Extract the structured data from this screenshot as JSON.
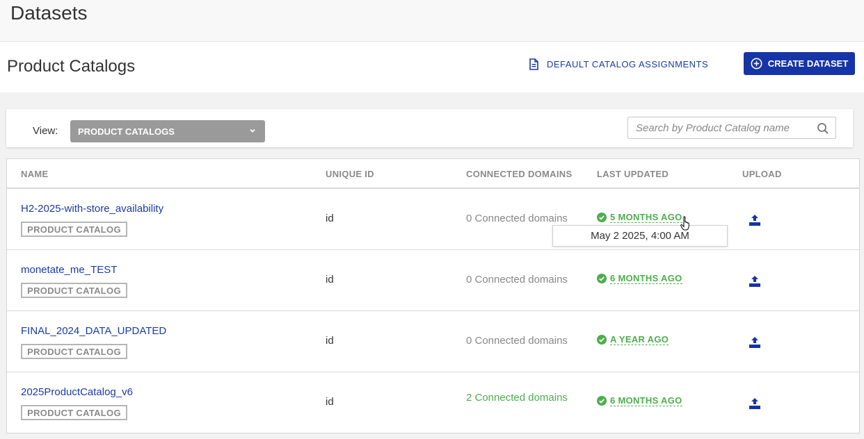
{
  "page": {
    "title": "Datasets"
  },
  "header": {
    "title": "Product Catalogs",
    "default_link": "DEFAULT CATALOG ASSIGNMENTS",
    "create_button": "CREATE DATASET"
  },
  "filter": {
    "view_label": "View:",
    "view_value": "PRODUCT CATALOGS",
    "search_placeholder": "Search by Product Catalog name"
  },
  "table": {
    "columns": [
      "NAME",
      "UNIQUE ID",
      "CONNECTED DOMAINS",
      "LAST UPDATED",
      "UPLOAD"
    ],
    "rows": [
      {
        "name": "H2-2025-with-store_availability",
        "badge": "PRODUCT CATALOG",
        "unique_id": "id",
        "domains": "0 Connected domains",
        "updated": "5 MONTHS AGO"
      },
      {
        "name": "monetate_me_TEST",
        "badge": "PRODUCT CATALOG",
        "unique_id": "id",
        "domains": "0 Connected domains",
        "updated": "6 MONTHS AGO"
      },
      {
        "name": "FINAL_2024_DATA_UPDATED",
        "badge": "PRODUCT CATALOG",
        "unique_id": "id",
        "domains": "0 Connected domains",
        "updated": "A YEAR AGO"
      },
      {
        "name": "2025ProductCatalog_v6",
        "badge": "PRODUCT CATALOG",
        "unique_id": "id",
        "domains": "2 Connected domains",
        "updated": "6 MONTHS AGO"
      }
    ]
  },
  "tooltip": {
    "text": "May 2 2025, 4:00 AM"
  },
  "colors": {
    "accent": "#1634a6",
    "link": "#1a3aa8",
    "success": "#4cae4c",
    "muted": "#8a8a8a"
  },
  "icons": {
    "doc": "document-icon",
    "plus": "plus-circle-icon",
    "chevron": "chevron-down-icon",
    "search": "search-icon",
    "check": "check-circle-icon",
    "upload": "upload-icon",
    "cursor": "hand-cursor-icon"
  }
}
